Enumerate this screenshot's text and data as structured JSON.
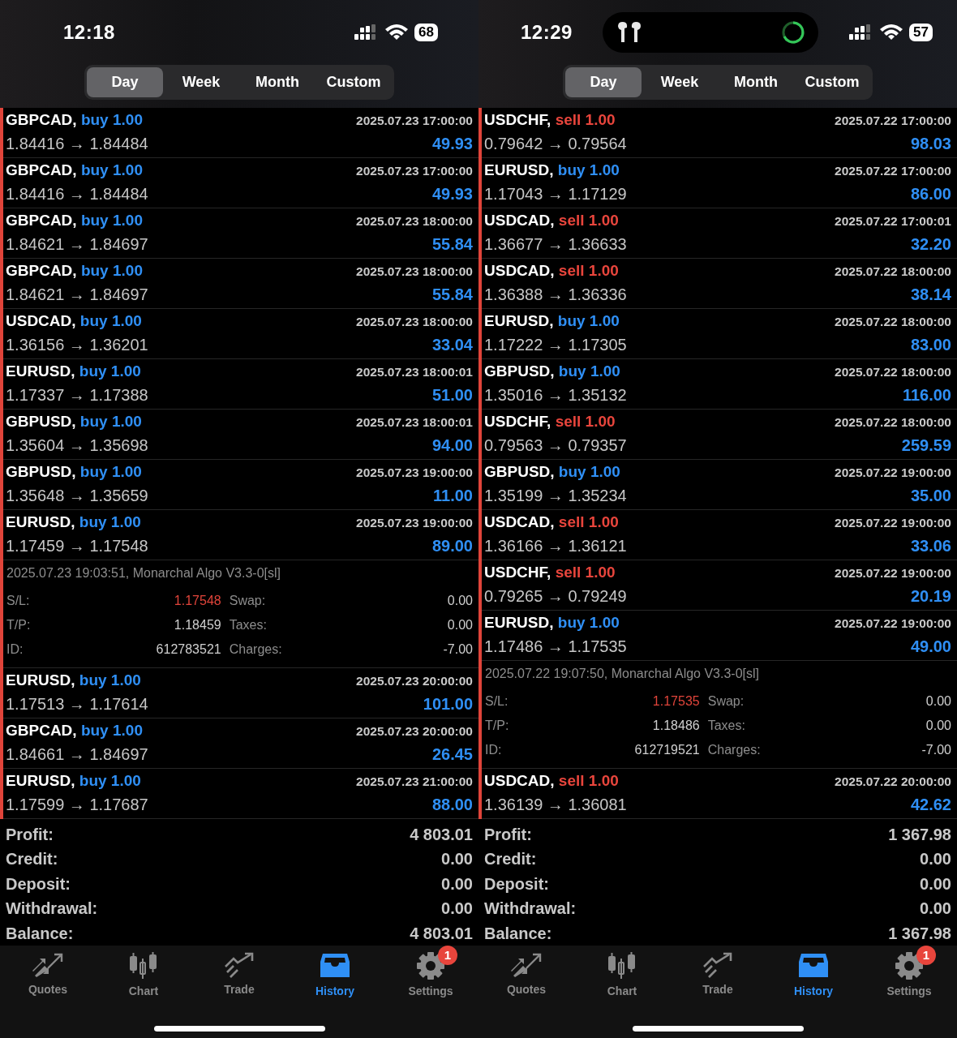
{
  "panels": [
    {
      "status_bar": {
        "time": "12:18",
        "battery": "68"
      },
      "period_tabs": [
        {
          "label": "Day",
          "selected": true
        },
        {
          "label": "Week",
          "selected": false
        },
        {
          "label": "Month",
          "selected": false
        },
        {
          "label": "Custom",
          "selected": false
        }
      ],
      "trades": [
        {
          "symbol": "GBPCAD,",
          "side": "buy",
          "volume": "1.00",
          "color": "#2f8ff5",
          "time": "2025.07.23 17:00:00",
          "prices": "1.84416 → 1.84484",
          "profit": "49.93"
        },
        {
          "symbol": "GBPCAD,",
          "side": "buy",
          "volume": "1.00",
          "color": "#2f8ff5",
          "time": "2025.07.23 17:00:00",
          "prices": "1.84416 → 1.84484",
          "profit": "49.93"
        },
        {
          "symbol": "GBPCAD,",
          "side": "buy",
          "volume": "1.00",
          "color": "#2f8ff5",
          "time": "2025.07.23 18:00:00",
          "prices": "1.84621 → 1.84697",
          "profit": "55.84"
        },
        {
          "symbol": "GBPCAD,",
          "side": "buy",
          "volume": "1.00",
          "color": "#2f8ff5",
          "time": "2025.07.23 18:00:00",
          "prices": "1.84621 → 1.84697",
          "profit": "55.84"
        },
        {
          "symbol": "USDCAD,",
          "side": "buy",
          "volume": "1.00",
          "color": "#2f8ff5",
          "time": "2025.07.23 18:00:00",
          "prices": "1.36156 → 1.36201",
          "profit": "33.04"
        },
        {
          "symbol": "EURUSD,",
          "side": "buy",
          "volume": "1.00",
          "color": "#2f8ff5",
          "time": "2025.07.23 18:00:01",
          "prices": "1.17337 → 1.17388",
          "profit": "51.00"
        },
        {
          "symbol": "GBPUSD,",
          "side": "buy",
          "volume": "1.00",
          "color": "#2f8ff5",
          "time": "2025.07.23 18:00:01",
          "prices": "1.35604 → 1.35698",
          "profit": "94.00"
        },
        {
          "symbol": "GBPUSD,",
          "side": "buy",
          "volume": "1.00",
          "color": "#2f8ff5",
          "time": "2025.07.23 19:00:00",
          "prices": "1.35648 → 1.35659",
          "profit": "11.00"
        },
        {
          "symbol": "EURUSD,",
          "side": "buy",
          "volume": "1.00",
          "color": "#2f8ff5",
          "time": "2025.07.23 19:00:00",
          "prices": "1.17459 → 1.17548",
          "profit": "89.00",
          "details": {
            "comment": "2025.07.23 19:03:51, Monarchal Algo V3.3-0[sl]",
            "fields": [
              {
                "label": "S/L:",
                "value": "1.17548",
                "color": "#e0443a"
              },
              {
                "label": "Swap:",
                "value": "0.00"
              },
              {
                "label": "T/P:",
                "value": "1.18459"
              },
              {
                "label": "Taxes:",
                "value": "0.00"
              },
              {
                "label": "ID:",
                "value": "612783521"
              },
              {
                "label": "Charges:",
                "value": "-7.00"
              }
            ]
          }
        },
        {
          "symbol": "EURUSD,",
          "side": "buy",
          "volume": "1.00",
          "color": "#2f8ff5",
          "time": "2025.07.23 20:00:00",
          "prices": "1.17513 → 1.17614",
          "profit": "101.00"
        },
        {
          "symbol": "GBPCAD,",
          "side": "buy",
          "volume": "1.00",
          "color": "#2f8ff5",
          "time": "2025.07.23 20:00:00",
          "prices": "1.84661 → 1.84697",
          "profit": "26.45"
        },
        {
          "symbol": "EURUSD,",
          "side": "buy",
          "volume": "1.00",
          "color": "#2f8ff5",
          "time": "2025.07.23 21:00:00",
          "prices": "1.17599 → 1.17687",
          "profit": "88.00"
        }
      ],
      "summary": [
        {
          "label": "Profit:",
          "value": "4 803.01"
        },
        {
          "label": "Credit:",
          "value": "0.00"
        },
        {
          "label": "Deposit:",
          "value": "0.00"
        },
        {
          "label": "Withdrawal:",
          "value": "0.00"
        },
        {
          "label": "Balance:",
          "value": "4 803.01"
        }
      ],
      "tab_bar": [
        {
          "label": "Quotes",
          "selected": false
        },
        {
          "label": "Chart",
          "selected": false
        },
        {
          "label": "Trade",
          "selected": false
        },
        {
          "label": "History",
          "selected": true
        },
        {
          "label": "Settings",
          "selected": false,
          "badge": "1"
        }
      ]
    },
    {
      "status_bar": {
        "time": "12:29",
        "battery": "57",
        "live_activity": true
      },
      "period_tabs": [
        {
          "label": "Day",
          "selected": true
        },
        {
          "label": "Week",
          "selected": false
        },
        {
          "label": "Month",
          "selected": false
        },
        {
          "label": "Custom",
          "selected": false
        }
      ],
      "trades": [
        {
          "symbol": "USDCHF,",
          "side": "sell",
          "volume": "1.00",
          "color": "#e8453c",
          "time": "2025.07.22 17:00:00",
          "prices": "0.79642 → 0.79564",
          "profit": "98.03"
        },
        {
          "symbol": "EURUSD,",
          "side": "buy",
          "volume": "1.00",
          "color": "#2f8ff5",
          "time": "2025.07.22 17:00:00",
          "prices": "1.17043 → 1.17129",
          "profit": "86.00"
        },
        {
          "symbol": "USDCAD,",
          "side": "sell",
          "volume": "1.00",
          "color": "#e8453c",
          "time": "2025.07.22 17:00:01",
          "prices": "1.36677 → 1.36633",
          "profit": "32.20"
        },
        {
          "symbol": "USDCAD,",
          "side": "sell",
          "volume": "1.00",
          "color": "#e8453c",
          "time": "2025.07.22 18:00:00",
          "prices": "1.36388 → 1.36336",
          "profit": "38.14"
        },
        {
          "symbol": "EURUSD,",
          "side": "buy",
          "volume": "1.00",
          "color": "#2f8ff5",
          "time": "2025.07.22 18:00:00",
          "prices": "1.17222 → 1.17305",
          "profit": "83.00"
        },
        {
          "symbol": "GBPUSD,",
          "side": "buy",
          "volume": "1.00",
          "color": "#2f8ff5",
          "time": "2025.07.22 18:00:00",
          "prices": "1.35016 → 1.35132",
          "profit": "116.00"
        },
        {
          "symbol": "USDCHF,",
          "side": "sell",
          "volume": "1.00",
          "color": "#e8453c",
          "time": "2025.07.22 18:00:00",
          "prices": "0.79563 → 0.79357",
          "profit": "259.59"
        },
        {
          "symbol": "GBPUSD,",
          "side": "buy",
          "volume": "1.00",
          "color": "#2f8ff5",
          "time": "2025.07.22 19:00:00",
          "prices": "1.35199 → 1.35234",
          "profit": "35.00"
        },
        {
          "symbol": "USDCAD,",
          "side": "sell",
          "volume": "1.00",
          "color": "#e8453c",
          "time": "2025.07.22 19:00:00",
          "prices": "1.36166 → 1.36121",
          "profit": "33.06"
        },
        {
          "symbol": "USDCHF,",
          "side": "sell",
          "volume": "1.00",
          "color": "#e8453c",
          "time": "2025.07.22 19:00:00",
          "prices": "0.79265 → 0.79249",
          "profit": "20.19"
        },
        {
          "symbol": "EURUSD,",
          "side": "buy",
          "volume": "1.00",
          "color": "#2f8ff5",
          "time": "2025.07.22 19:00:00",
          "prices": "1.17486 → 1.17535",
          "profit": "49.00",
          "details": {
            "comment": "2025.07.22 19:07:50, Monarchal Algo V3.3-0[sl]",
            "fields": [
              {
                "label": "S/L:",
                "value": "1.17535",
                "color": "#e0443a"
              },
              {
                "label": "Swap:",
                "value": "0.00"
              },
              {
                "label": "T/P:",
                "value": "1.18486"
              },
              {
                "label": "Taxes:",
                "value": "0.00"
              },
              {
                "label": "ID:",
                "value": "612719521"
              },
              {
                "label": "Charges:",
                "value": "-7.00"
              }
            ]
          }
        },
        {
          "symbol": "USDCAD,",
          "side": "sell",
          "volume": "1.00",
          "color": "#e8453c",
          "time": "2025.07.22 20:00:00",
          "prices": "1.36139 → 1.36081",
          "profit": "42.62"
        }
      ],
      "summary": [
        {
          "label": "Profit:",
          "value": "1 367.98"
        },
        {
          "label": "Credit:",
          "value": "0.00"
        },
        {
          "label": "Deposit:",
          "value": "0.00"
        },
        {
          "label": "Withdrawal:",
          "value": "0.00"
        },
        {
          "label": "Balance:",
          "value": "1 367.98"
        }
      ],
      "tab_bar": [
        {
          "label": "Quotes",
          "selected": false
        },
        {
          "label": "Chart",
          "selected": false
        },
        {
          "label": "Trade",
          "selected": false
        },
        {
          "label": "History",
          "selected": true
        },
        {
          "label": "Settings",
          "selected": false,
          "badge": "1"
        }
      ]
    }
  ]
}
